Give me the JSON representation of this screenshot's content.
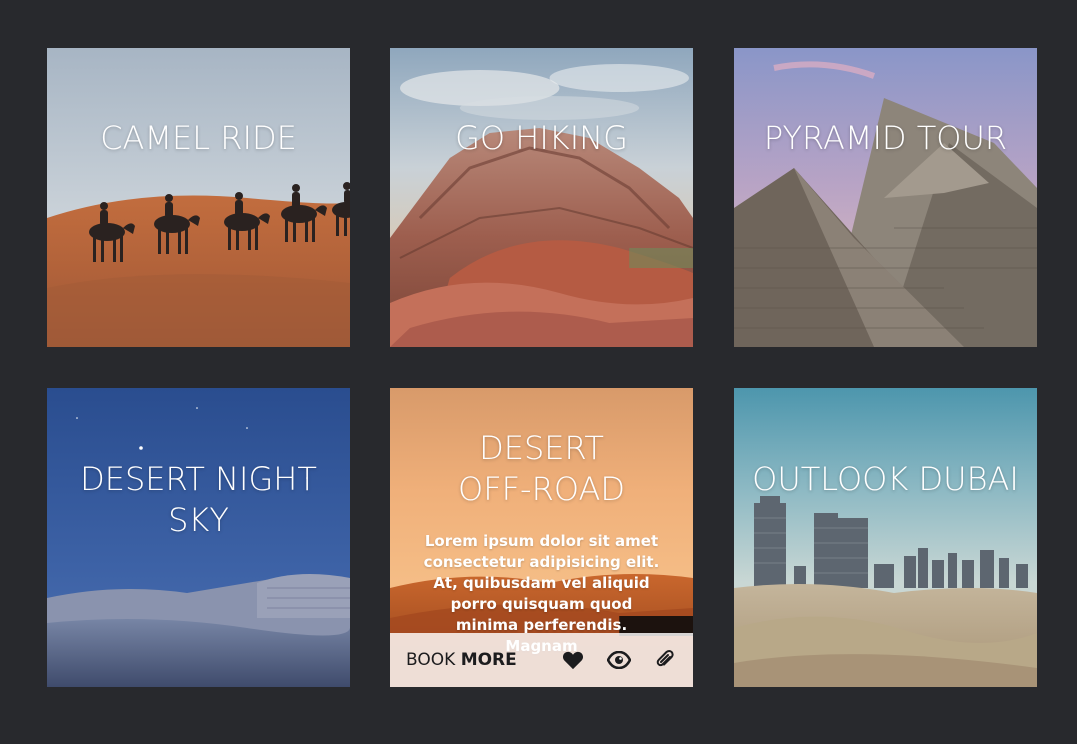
{
  "cards": [
    {
      "title": "CAMEL RIDE"
    },
    {
      "title": "GO HIKING"
    },
    {
      "title": "PYRAMID TOUR"
    },
    {
      "title": "DESERT NIGHT\nSKY"
    },
    {
      "title": "DESERT\nOFF-ROAD",
      "description": "Lorem ipsum dolor sit amet consectetur adipisicing elit. At, quibusdam vel aliquid porro quisquam quod minima perferendis. Magnam",
      "footer": {
        "book_label": "BOOK",
        "more_label": "MORE",
        "icons": [
          "heart-icon",
          "eye-icon",
          "paperclip-icon"
        ]
      }
    },
    {
      "title": "OUTLOOK DUBAI"
    }
  ],
  "colors": {
    "page_background": "#28292d",
    "title_text": "#ffffff",
    "footer_background": "#ffffff",
    "footer_text": "#1c1c1e"
  }
}
